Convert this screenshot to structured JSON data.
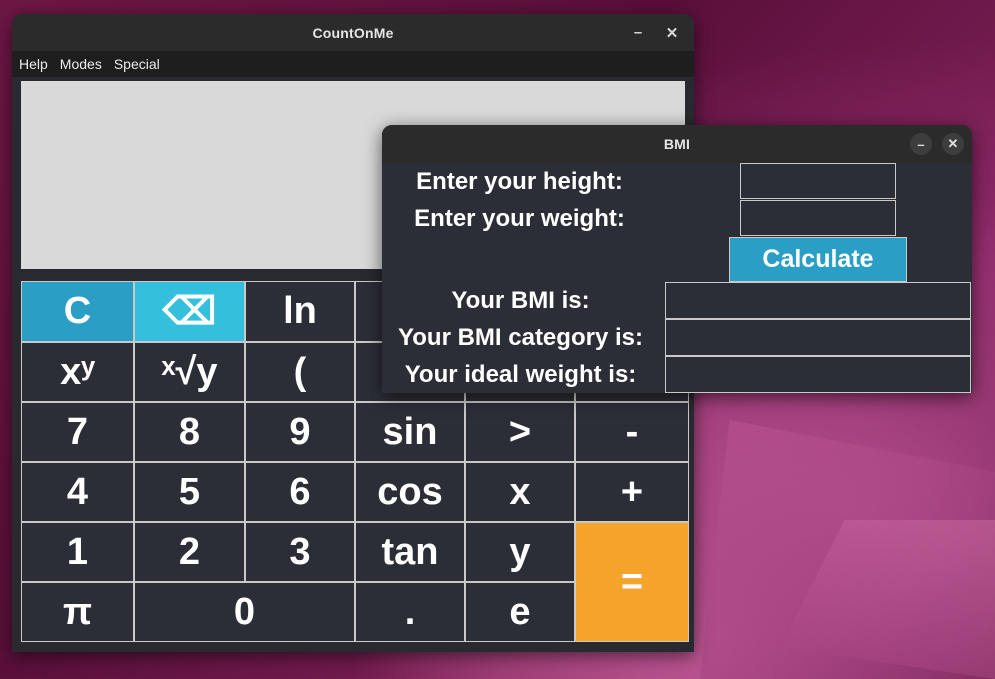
{
  "desktop": {
    "wallpaper": "ubuntu-purple"
  },
  "calculator": {
    "title": "CountOnMe",
    "menu": [
      "Help",
      "Modes",
      "Special"
    ],
    "display_value": "",
    "keys": [
      "C",
      "⌫",
      "ln",
      "xʸ",
      "ˣ√y",
      "(",
      "7",
      "8",
      "9",
      "sin",
      ">",
      "-",
      "4",
      "5",
      "6",
      "cos",
      "x",
      "+",
      "1",
      "2",
      "3",
      "tan",
      "y",
      "=",
      "π",
      "0",
      ".",
      "e"
    ],
    "colors": {
      "clear": "#2a9ec4",
      "backspace": "#34c0dc",
      "equals": "#f5a32b",
      "key": "#2c2e37"
    }
  },
  "bmi": {
    "title": "BMI",
    "height_label": "Enter your height:",
    "weight_label": "Enter your weight:",
    "height_value": "",
    "weight_value": "",
    "calculate_label": "Calculate",
    "result_label": "Your BMI is:",
    "category_label": "Your BMI category is:",
    "ideal_label": "Your ideal weight is:",
    "result_value": "",
    "category_value": "",
    "ideal_value": ""
  },
  "window_controls": {
    "minimize": "–",
    "close": "✕"
  }
}
